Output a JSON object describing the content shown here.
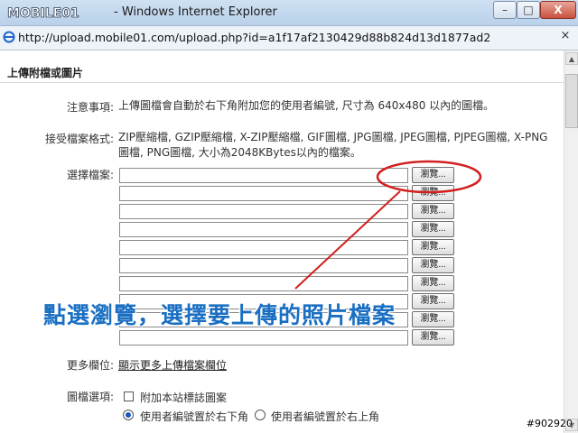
{
  "window": {
    "logo_text": "MOBILE01",
    "title": "- Windows Internet Explorer",
    "controls": {
      "minimize": "–",
      "maximize": "□",
      "close": "X"
    }
  },
  "address_bar": {
    "url": "http://upload.mobile01.com/upload.php?id=a1f17af2130429d88b824d13d1877ad2",
    "close_glyph": "×"
  },
  "page": {
    "section_title": "上傳附檔或圖片",
    "notice_label": "注意事項:",
    "notice_text": "上傳圖檔會自動於右下角附加您的使用者編號, 尺寸為 640x480 以內的圖檔。",
    "formats_label": "接受檔案格式:",
    "formats_text": "ZIP壓縮檔, GZIP壓縮檔, X-ZIP壓縮檔, GIF圖檔, JPG圖檔, JPEG圖檔, PJPEG圖檔, X-PNG圖檔, PNG圖檔, 大小為2048KBytes以內的檔案。",
    "select_label": "選擇檔案:",
    "browse_label": "瀏覽...",
    "more_label": "更多欄位:",
    "more_link": "顯示更多上傳檔案欄位",
    "options_label": "圖檔選項:",
    "checkbox_label": "附加本站標誌圖案",
    "checkbox_checked": false,
    "radio_bottom_right": "使用者編號置於右下角",
    "radio_top_right": "使用者編號置於右上角",
    "radio_selected": "bottom_right"
  },
  "annotation": {
    "callout_text": "點選瀏覽，選擇要上傳的照片檔案",
    "callout_color": "#1a6fc2",
    "ellipse_color": "#d21f1f"
  },
  "watermark": "#902920",
  "colors": {
    "titlebar": "#c5daf0",
    "link": "#222222"
  }
}
